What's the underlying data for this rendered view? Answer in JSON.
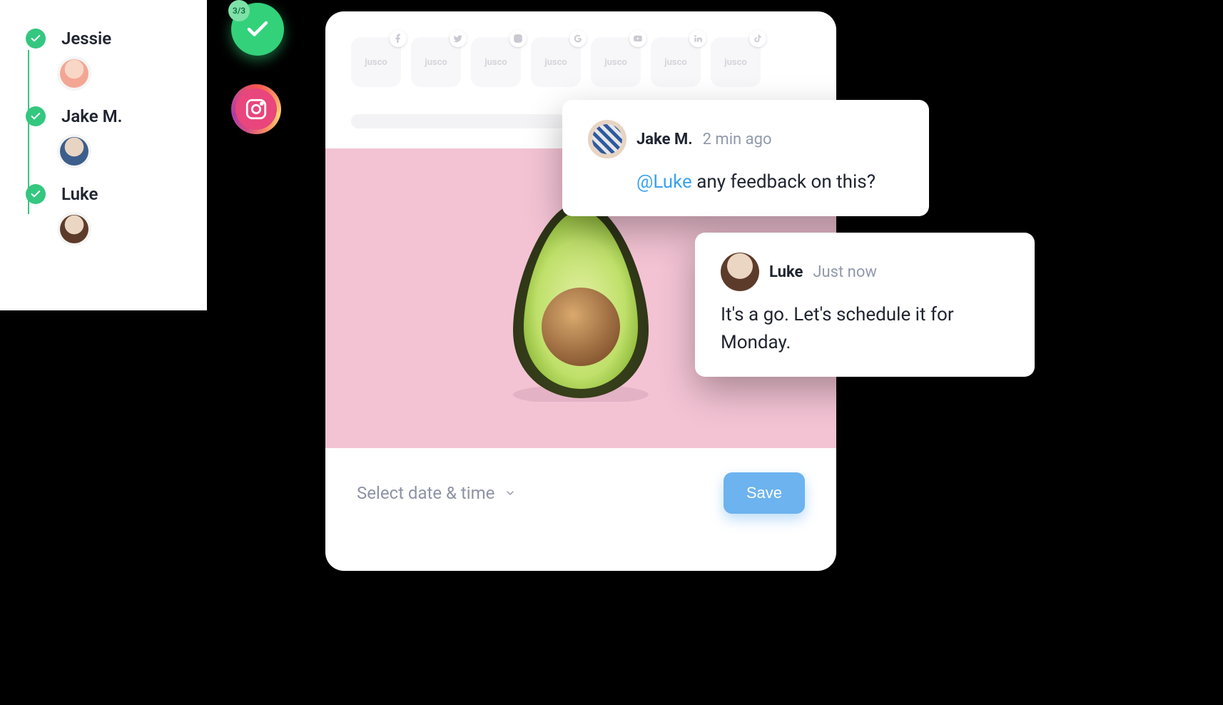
{
  "approvers": [
    {
      "name": "Jessie"
    },
    {
      "name": "Jake M."
    },
    {
      "name": "Luke"
    }
  ],
  "badge": {
    "counter": "3/3"
  },
  "platforms": [
    {
      "label": "jusco",
      "network": "facebook"
    },
    {
      "label": "jusco",
      "network": "twitter"
    },
    {
      "label": "jusco",
      "network": "instagram"
    },
    {
      "label": "jusco",
      "network": "google"
    },
    {
      "label": "jusco",
      "network": "youtube"
    },
    {
      "label": "jusco",
      "network": "linkedin"
    },
    {
      "label": "jusco",
      "network": "tiktok"
    }
  ],
  "footer": {
    "date_label": "Select date & time",
    "save_label": "Save"
  },
  "comments": [
    {
      "author": "Jake M.",
      "time": "2 min ago",
      "mention": "@Luke",
      "body_rest": " any feedback on this?"
    },
    {
      "author": "Luke",
      "time": "Just now",
      "body": "It's a go. Let's schedule it for Monday."
    }
  ]
}
